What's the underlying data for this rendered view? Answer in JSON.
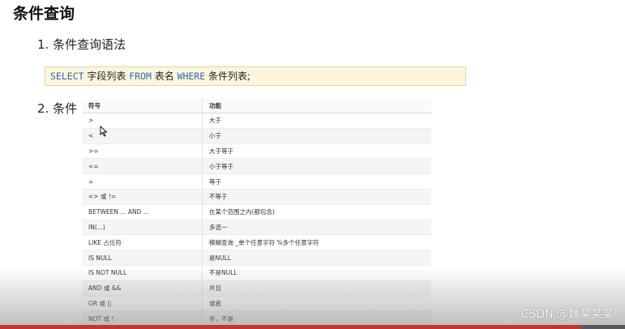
{
  "slide": {
    "title": "条件查询",
    "section1": "1. 条件查询语法",
    "section2": "2. 条件"
  },
  "syntax": {
    "select_kw": "SELECT",
    "fields": " 字段列表 ",
    "from_kw": "FROM",
    "table": " 表名 ",
    "where_kw": "WHERE",
    "conditions": " 条件列表;"
  },
  "table": {
    "headers": [
      "符号",
      "功能"
    ],
    "rows": [
      [
        ">",
        "大于"
      ],
      [
        "<",
        "小于"
      ],
      [
        ">=",
        "大于等于"
      ],
      [
        "<=",
        "小于等于"
      ],
      [
        "=",
        "等于"
      ],
      [
        "<> 或 !=",
        "不等于"
      ],
      [
        "BETWEEN ... AND ...",
        "在某个范围之内(都包含)"
      ],
      [
        "IN(...)",
        "多选一"
      ],
      [
        "LIKE 占位符",
        "模糊查询 _单个任意字符 %多个任意字符"
      ],
      [
        "IS NULL",
        "是NULL"
      ],
      [
        "IS NOT NULL",
        "不是NULL"
      ],
      [
        "AND 或 &&",
        "并且"
      ],
      [
        "OR 或 ||",
        "或者"
      ],
      [
        "NOT 或 !",
        "非，不是"
      ]
    ]
  },
  "watermark": "CSDN @魏某某某",
  "player": {
    "progress": 0.93,
    "accent_color": "#c0392b"
  },
  "cursor_icon": "mouse-pointer-icon"
}
